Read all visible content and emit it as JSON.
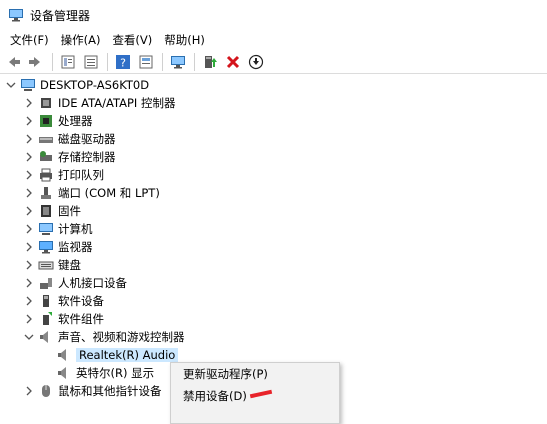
{
  "window": {
    "title": "设备管理器"
  },
  "menu": [
    "文件(F)",
    "操作(A)",
    "查看(V)",
    "帮助(H)"
  ],
  "toolbar": [
    "back-icon",
    "forward-icon",
    "properties-icon",
    "list-icon",
    "help-icon",
    "details-icon",
    "monitor-icon",
    "update-driver-icon",
    "uninstall-icon",
    "scan-icon"
  ],
  "tree": {
    "root": "DESKTOP-AS6KT0D",
    "categories": [
      {
        "label": "IDE ATA/ATAPI 控制器",
        "icon": "ide-controller-icon"
      },
      {
        "label": "处理器",
        "icon": "processor-icon"
      },
      {
        "label": "磁盘驱动器",
        "icon": "disk-drive-icon"
      },
      {
        "label": "存储控制器",
        "icon": "storage-controller-icon"
      },
      {
        "label": "打印队列",
        "icon": "printer-icon"
      },
      {
        "label": "端口 (COM 和 LPT)",
        "icon": "port-icon"
      },
      {
        "label": "固件",
        "icon": "firmware-icon"
      },
      {
        "label": "计算机",
        "icon": "computer-icon"
      },
      {
        "label": "监视器",
        "icon": "monitor-icon"
      },
      {
        "label": "键盘",
        "icon": "keyboard-icon"
      },
      {
        "label": "人机接口设备",
        "icon": "hid-icon"
      },
      {
        "label": "软件设备",
        "icon": "software-device-icon"
      },
      {
        "label": "软件组件",
        "icon": "software-component-icon"
      },
      {
        "label": "声音、视频和游戏控制器",
        "icon": "speaker-icon"
      }
    ],
    "children": [
      {
        "label": "Realtek(R) Audio",
        "icon": "speaker-icon"
      },
      {
        "label": "英特尔(R) 显示",
        "icon": "speaker-icon"
      }
    ],
    "next": {
      "label": "鼠标和其他指针设备",
      "icon": "mouse-icon"
    }
  },
  "context_menu": [
    "更新驱动程序(P)",
    "禁用设备(D)"
  ],
  "colors": {
    "selection": "#cce8ff",
    "accent_red": "#e8232a"
  }
}
